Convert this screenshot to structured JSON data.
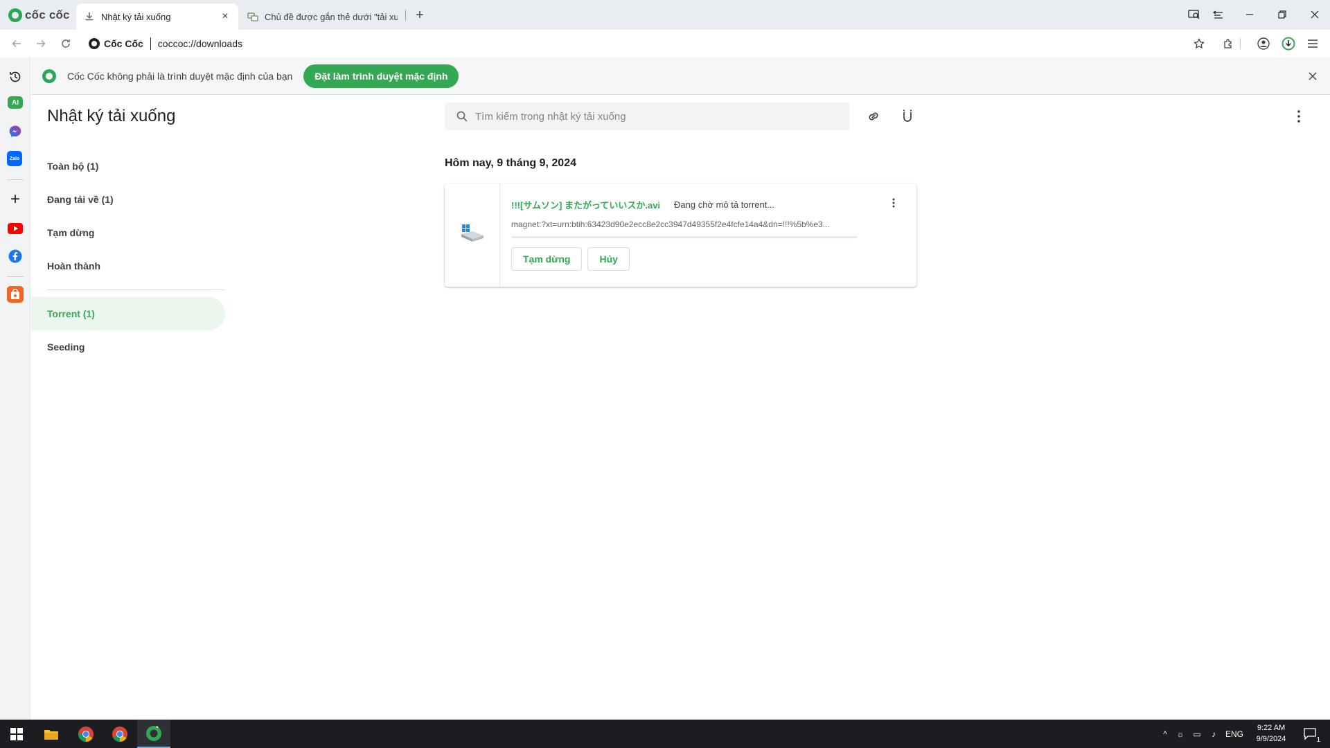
{
  "browser": {
    "brand": "cốc cốc",
    "tabs": [
      {
        "title": "Nhật ký tải xuống",
        "active": true
      },
      {
        "title": "Chủ đề được gắn thẻ dưới \"tải xuố",
        "active": false
      }
    ],
    "omnibox": {
      "site_name": "Cốc Cốc",
      "url": "coccoc://downloads"
    }
  },
  "infobar": {
    "message": "Cốc Cốc không phải là trình duyệt mặc định của bạn",
    "button_label": "Đặt làm trình duyệt mặc định"
  },
  "page": {
    "title": "Nhật ký tải xuống",
    "search_placeholder": "Tìm kiếm trong nhật ký tải xuống",
    "menu": [
      {
        "label": "Toàn bộ (1)"
      },
      {
        "label": "Đang tải về (1)"
      },
      {
        "label": "Tạm dừng"
      },
      {
        "label": "Hoàn thành"
      }
    ],
    "menu_secondary": [
      {
        "label": "Torrent (1)",
        "selected": true
      },
      {
        "label": "Seeding"
      }
    ],
    "date_heading": "Hôm nay, 9 tháng 9, 2024",
    "download": {
      "file_name": "!!![サムソン] またがっていいスか.avi",
      "status": "Đang chờ mô tả torrent...",
      "url": "magnet:?xt=urn:btih:63423d90e2ecc8e2cc3947d49355f2e4fcfe14a4&dn=!!!%5b%e3...",
      "progress": 0,
      "pause_label": "Tạm dừng",
      "cancel_label": "Hủy"
    }
  },
  "rail": {
    "ai_label": "AI",
    "zalo_label": "Zalo"
  },
  "taskbar": {
    "language": "ENG",
    "time": "9:22 AM",
    "date": "9/9/2024",
    "notification_count": "1"
  },
  "colors": {
    "accent": "#35a853",
    "infobar_bg": "#f5f6f7",
    "selected_menu_bg": "#eaf6ee",
    "taskbar_bg": "#1b1d21"
  }
}
